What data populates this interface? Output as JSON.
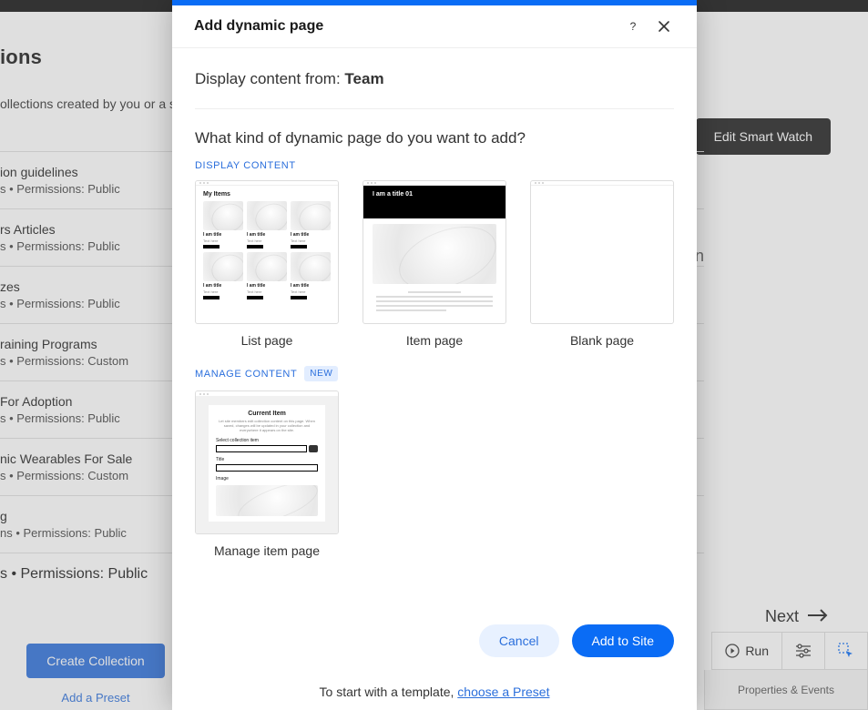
{
  "background": {
    "heading_suffix": "ions",
    "desc_suffix": "ollections created by you or a s",
    "edit_button": "Edit Smart Watch",
    "trailing_n": "n",
    "collections": [
      {
        "name_suffix": "ion guidelines",
        "meta_suffix": "s • Permissions: Public"
      },
      {
        "name_suffix": "rs Articles",
        "meta_suffix": "s • Permissions: Public"
      },
      {
        "name_suffix": "zes",
        "meta_suffix": "s • Permissions: Public"
      },
      {
        "name_suffix": "raining Programs",
        "meta_suffix": "s • Permissions: Custom"
      },
      {
        "name_suffix": "For Adoption",
        "meta_suffix": "s • Permissions: Public"
      },
      {
        "name_suffix": "nic Wearables For Sale",
        "meta_suffix": "s • Permissions: Custom"
      },
      {
        "name_suffix": "g",
        "meta_suffix": "ns • Permissions: Public"
      }
    ],
    "last_meta": "s • Permissions: Public",
    "create_collection": "Create Collection",
    "add_preset": "Add a Preset",
    "next": "Next",
    "run": "Run",
    "properties_events": "Properties & Events"
  },
  "modal": {
    "title": "Add dynamic page",
    "display_from_label": "Display content from: ",
    "display_from_value": "Team",
    "question": "What kind of dynamic page do you want to add?",
    "section_display": "DISPLAY CONTENT",
    "section_manage": "MANAGE CONTENT",
    "new_badge": "NEW",
    "cards": {
      "list": "List page",
      "item": "Item page",
      "blank": "Blank page",
      "manage": "Manage item page"
    },
    "thumb_list_title": "My Items",
    "thumb_item_title": "I am a title 01",
    "thumb_manage_title": "Current Item",
    "thumb_manage_field1": "Title",
    "thumb_manage_field2": "Image",
    "cancel": "Cancel",
    "add_to_site": "Add to Site",
    "footer_note_prefix": "To start with a template, ",
    "footer_note_link": "choose a Preset"
  }
}
